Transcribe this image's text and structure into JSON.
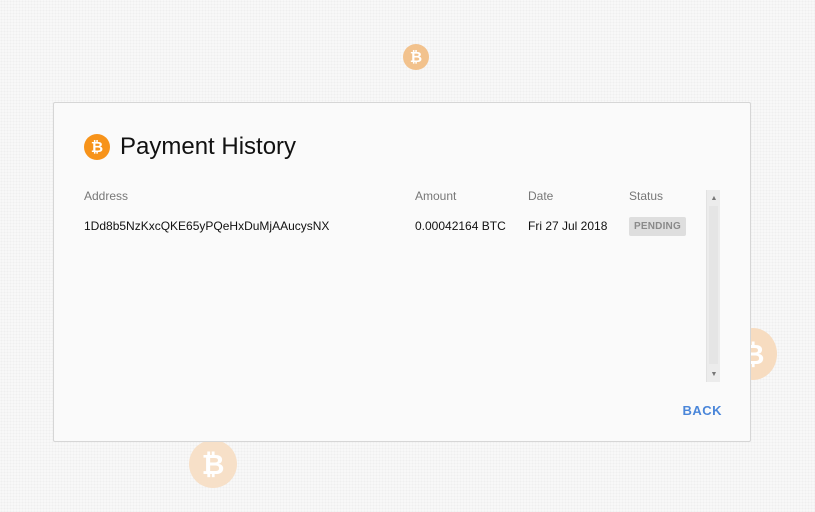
{
  "background": {
    "coin_symbol": "₿",
    "coin_color": "#f7931a"
  },
  "dialog": {
    "title": "Payment History",
    "title_icon": "bitcoin-icon",
    "table": {
      "headers": {
        "address": "Address",
        "amount": "Amount",
        "date": "Date",
        "status": "Status"
      },
      "rows": [
        {
          "address": "1Dd8b5NzKxcQKE65yPQeHxDuMjAAucysNX",
          "amount": "0.00042164 BTC",
          "date": "Fri 27 Jul 2018",
          "status": "PENDING"
        }
      ]
    },
    "back_label": "BACK",
    "accent_color": "#4a86d9"
  }
}
